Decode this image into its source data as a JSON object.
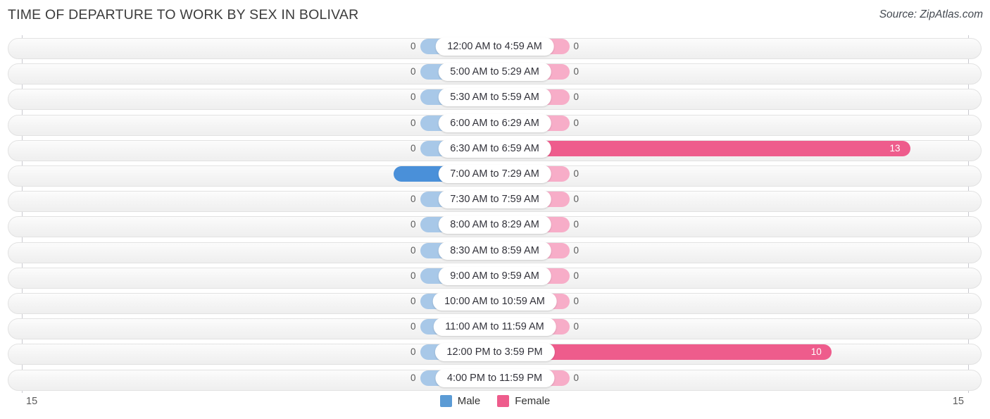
{
  "header": {
    "title": "TIME OF DEPARTURE TO WORK BY SEX IN BOLIVAR",
    "source": "Source: ZipAtlas.com"
  },
  "axis": {
    "tick_left": "15",
    "tick_right": "15",
    "max": 15
  },
  "legend": {
    "items": [
      {
        "label": "Male",
        "color": "#5B9BD5"
      },
      {
        "label": "Female",
        "color": "#EE5C8C"
      }
    ]
  },
  "colors": {
    "male_zero": "#A8C8E8",
    "male_value": "#4A90D9",
    "female_zero": "#F7ADC8",
    "female_value": "#EE5C8C",
    "row_background": "#F4F4F4",
    "row_border": "#E2E2E2"
  },
  "chart_data": {
    "type": "bar",
    "title": "TIME OF DEPARTURE TO WORK BY SEX IN BOLIVAR",
    "subtitle": "Source: ZipAtlas.com",
    "orientation": "horizontal-diverging",
    "xlabel": "",
    "ylabel": "",
    "xlim": [
      15,
      15
    ],
    "grid": false,
    "legend_position": "bottom-center",
    "categories": [
      "12:00 AM to 4:59 AM",
      "5:00 AM to 5:29 AM",
      "5:30 AM to 5:59 AM",
      "6:00 AM to 6:29 AM",
      "6:30 AM to 6:59 AM",
      "7:00 AM to 7:29 AM",
      "7:30 AM to 7:59 AM",
      "8:00 AM to 8:29 AM",
      "8:30 AM to 8:59 AM",
      "9:00 AM to 9:59 AM",
      "10:00 AM to 10:59 AM",
      "11:00 AM to 11:59 AM",
      "12:00 PM to 3:59 PM",
      "4:00 PM to 11:59 PM"
    ],
    "series": [
      {
        "name": "Male",
        "values": [
          0,
          0,
          0,
          0,
          0,
          1,
          0,
          0,
          0,
          0,
          0,
          0,
          0,
          0
        ]
      },
      {
        "name": "Female",
        "values": [
          0,
          0,
          0,
          0,
          13,
          0,
          0,
          0,
          0,
          0,
          0,
          0,
          10,
          0
        ]
      }
    ],
    "rows": [
      {
        "label": "12:00 AM to 4:59 AM",
        "male": "0",
        "female": "0"
      },
      {
        "label": "5:00 AM to 5:29 AM",
        "male": "0",
        "female": "0"
      },
      {
        "label": "5:30 AM to 5:59 AM",
        "male": "0",
        "female": "0"
      },
      {
        "label": "6:00 AM to 6:29 AM",
        "male": "0",
        "female": "0"
      },
      {
        "label": "6:30 AM to 6:59 AM",
        "male": "0",
        "female": "13"
      },
      {
        "label": "7:00 AM to 7:29 AM",
        "male": "1",
        "female": "0"
      },
      {
        "label": "7:30 AM to 7:59 AM",
        "male": "0",
        "female": "0"
      },
      {
        "label": "8:00 AM to 8:29 AM",
        "male": "0",
        "female": "0"
      },
      {
        "label": "8:30 AM to 8:59 AM",
        "male": "0",
        "female": "0"
      },
      {
        "label": "9:00 AM to 9:59 AM",
        "male": "0",
        "female": "0"
      },
      {
        "label": "10:00 AM to 10:59 AM",
        "male": "0",
        "female": "0"
      },
      {
        "label": "11:00 AM to 11:59 AM",
        "male": "0",
        "female": "0"
      },
      {
        "label": "12:00 PM to 3:59 PM",
        "male": "0",
        "female": "10"
      },
      {
        "label": "4:00 PM to 11:59 PM",
        "male": "0",
        "female": "0"
      }
    ]
  }
}
